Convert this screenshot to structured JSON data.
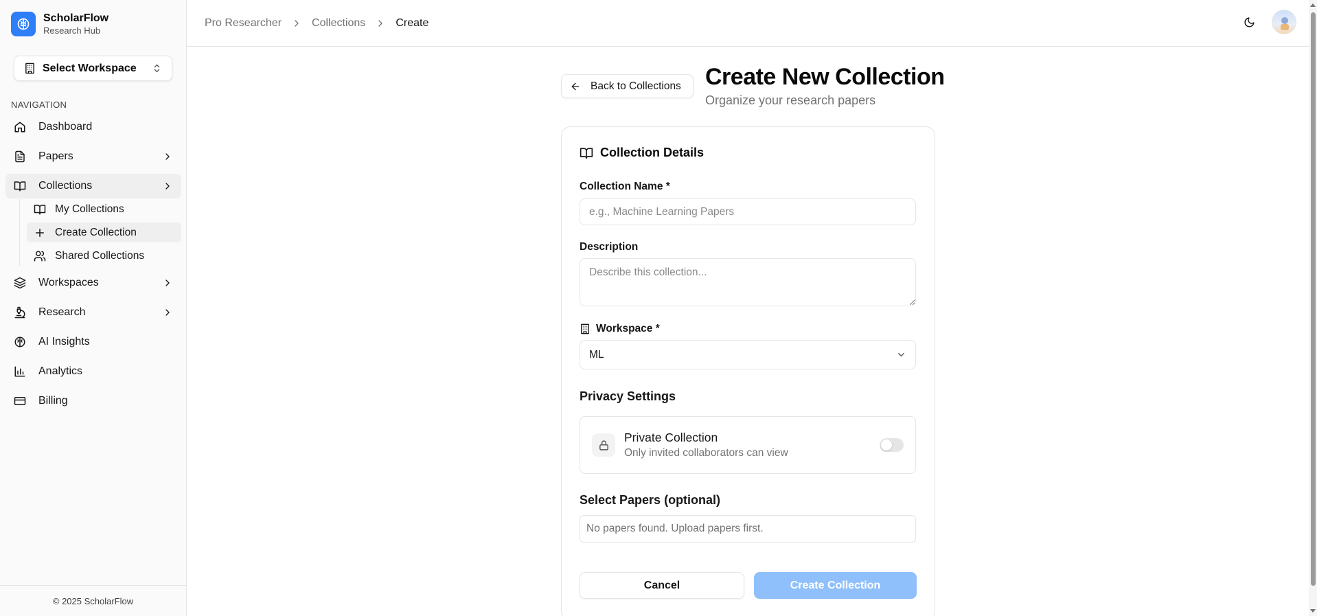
{
  "brand": {
    "name": "ScholarFlow",
    "subtitle": "Research Hub",
    "icon": "brain-icon",
    "color": "#2d7ef7"
  },
  "workspace_selector": {
    "label": "Select Workspace",
    "icon": "building-icon"
  },
  "nav": {
    "title": "NAVIGATION",
    "items": [
      {
        "label": "Dashboard",
        "icon": "home-icon"
      },
      {
        "label": "Papers",
        "icon": "file-text-icon"
      },
      {
        "label": "Collections",
        "icon": "book-open-icon"
      },
      {
        "label": "Workspaces",
        "icon": "layers-icon"
      },
      {
        "label": "Research",
        "icon": "microscope-icon"
      },
      {
        "label": "AI Insights",
        "icon": "brain-icon"
      },
      {
        "label": "Analytics",
        "icon": "bar-chart-icon"
      },
      {
        "label": "Billing",
        "icon": "credit-card-icon"
      }
    ],
    "collections_sub": [
      {
        "label": "My Collections",
        "icon": "book-open-icon"
      },
      {
        "label": "Create Collection",
        "icon": "plus-icon"
      },
      {
        "label": "Shared Collections",
        "icon": "users-icon"
      }
    ]
  },
  "footer": {
    "text": "© 2025 ScholarFlow"
  },
  "breadcrumb": [
    "Pro Researcher",
    "Collections",
    "Create"
  ],
  "header": {
    "back_label": "Back to Collections",
    "title": "Create New Collection",
    "subtitle": "Organize your research papers"
  },
  "form": {
    "card_title": "Collection Details",
    "name_label": "Collection Name *",
    "name_placeholder": "e.g., Machine Learning Papers",
    "name_value": "",
    "description_label": "Description",
    "description_placeholder": "Describe this collection...",
    "workspace_label": "Workspace *",
    "workspace_value": "ML",
    "privacy_title": "Privacy Settings",
    "private_label": "Private Collection",
    "private_desc": "Only invited collaborators can view",
    "private_enabled": false,
    "papers_label": "Select Papers (optional)",
    "papers_empty": "No papers found. Upload papers first.",
    "cancel_label": "Cancel",
    "create_label": "Create Collection"
  },
  "colors": {
    "accent": "#2d7ef7",
    "create_disabled": "#8fc0fb"
  }
}
